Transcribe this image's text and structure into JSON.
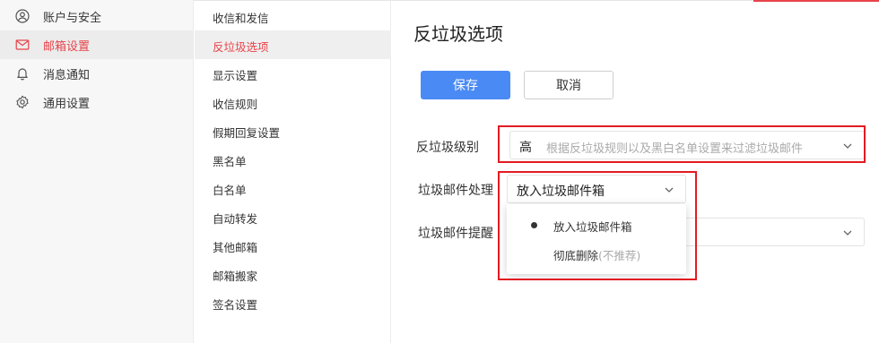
{
  "sidebar": {
    "items": [
      {
        "label": "账户与安全",
        "icon": "user-circle-icon"
      },
      {
        "label": "邮箱设置",
        "icon": "mail-icon"
      },
      {
        "label": "消息通知",
        "icon": "bell-icon"
      },
      {
        "label": "通用设置",
        "icon": "gear-icon"
      }
    ],
    "active_index": 1
  },
  "submenu": {
    "items": [
      "收信和发信",
      "反垃圾选项",
      "显示设置",
      "收信规则",
      "假期回复设置",
      "黑名单",
      "白名单",
      "自动转发",
      "其他邮箱",
      "邮箱搬家",
      "签名设置"
    ],
    "active_index": 1
  },
  "main": {
    "title": "反垃圾选项",
    "save_label": "保存",
    "cancel_label": "取消",
    "spam_level": {
      "label": "反垃圾级别",
      "value": "高",
      "hint": "根据反垃圾规则以及黑白名单设置来过滤垃圾邮件"
    },
    "spam_handling": {
      "label": "垃圾邮件处理",
      "value": "放入垃圾邮件箱",
      "options": [
        {
          "label": "放入垃圾邮件箱",
          "note": "",
          "selected": true
        },
        {
          "label": "彻底删除",
          "note": "(不推荐)",
          "selected": false
        }
      ]
    },
    "spam_reminder": {
      "label": "垃圾邮件提醒"
    }
  },
  "colors": {
    "accent": "#e8434a",
    "primary": "#4a8af4",
    "highlight_box": "#e21b22"
  }
}
